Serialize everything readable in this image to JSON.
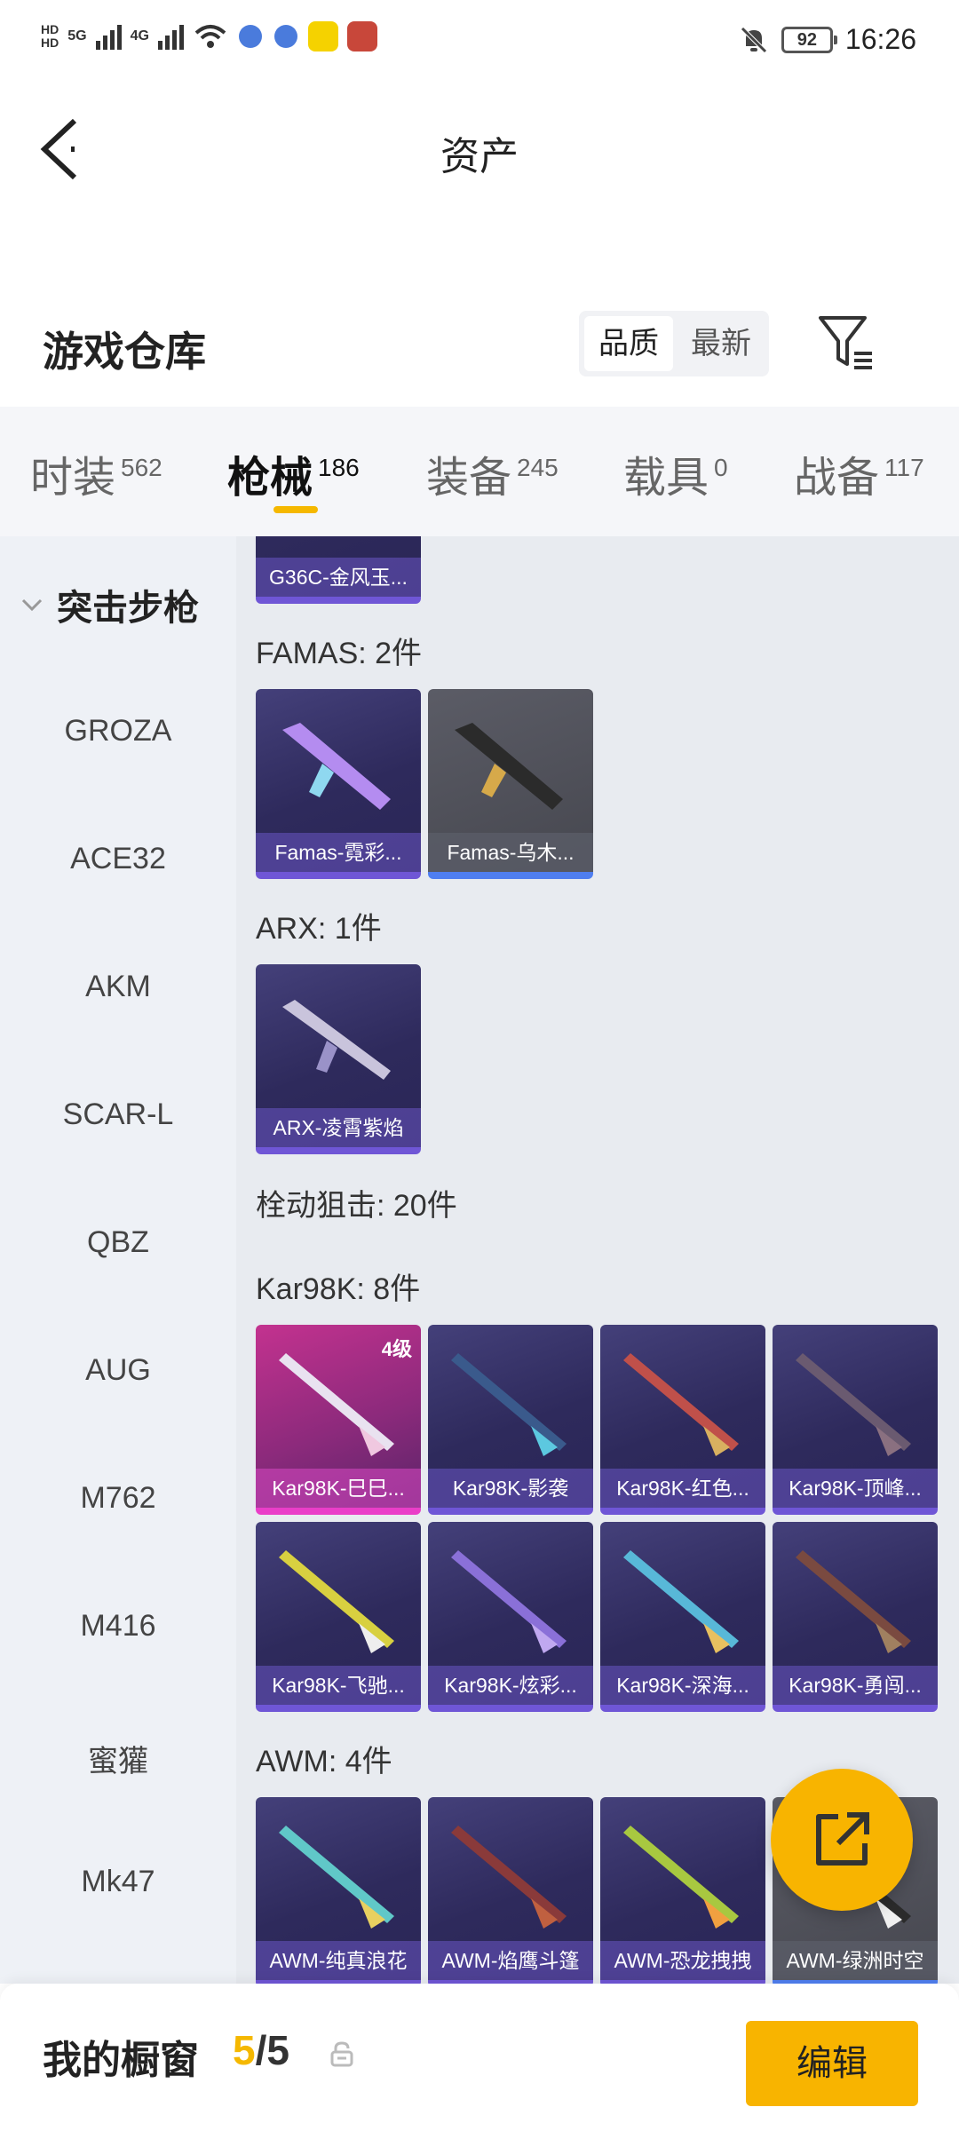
{
  "status_bar": {
    "left_hd_top": "HD",
    "left_hd_bottom": "HD",
    "net1": "5G",
    "net2": "4G",
    "battery": "92",
    "time": "16:26"
  },
  "header": {
    "title": "资产"
  },
  "warehouse": {
    "title": "游戏仓库",
    "sort_options": [
      "品质",
      "最新"
    ]
  },
  "tabs": [
    {
      "label": "时装",
      "count": "562"
    },
    {
      "label": "枪械",
      "count": "186"
    },
    {
      "label": "装备",
      "count": "245"
    },
    {
      "label": "载具",
      "count": "0"
    },
    {
      "label": "战备",
      "count": "117"
    }
  ],
  "sidebar": {
    "category": "突击步枪",
    "items": [
      "GROZA",
      "ACE32",
      "AKM",
      "SCAR-L",
      "QBZ",
      "AUG",
      "M762",
      "M416",
      "蜜獾",
      "Mk47"
    ]
  },
  "content": {
    "top_card": "G36C-金风玉...",
    "sections": [
      {
        "title": "FAMAS: 2件",
        "cards": [
          "Famas-霓彩...",
          "Famas-乌木..."
        ]
      },
      {
        "title": "ARX: 1件",
        "cards": [
          "ARX-凌霄紫焰"
        ]
      },
      {
        "title": "栓动狙击: 20件",
        "cards": []
      },
      {
        "title": "Kar98K: 8件",
        "cards": [
          "Kar98K-巳巳...",
          "Kar98K-影袭",
          "Kar98K-红色...",
          "Kar98K-顶峰...",
          "Kar98K-飞驰...",
          "Kar98K-炫彩...",
          "Kar98K-深海...",
          "Kar98K-勇闯..."
        ]
      },
      {
        "title": "AWM: 4件",
        "cards": [
          "AWM-纯真浪花",
          "AWM-焰鹰斗篷",
          "AWM-恐龙拽拽",
          "AWM-绿洲时空"
        ]
      }
    ],
    "level_badge": "4级"
  },
  "bottom_bar": {
    "showcase_label": "我的橱窗",
    "count_current": "5",
    "count_sep_total": "/5",
    "edit_label": "编辑"
  },
  "colors": {
    "accent": "#f8b400",
    "card_purple": "#2e2a5c",
    "card_pink": "#c3328f"
  }
}
